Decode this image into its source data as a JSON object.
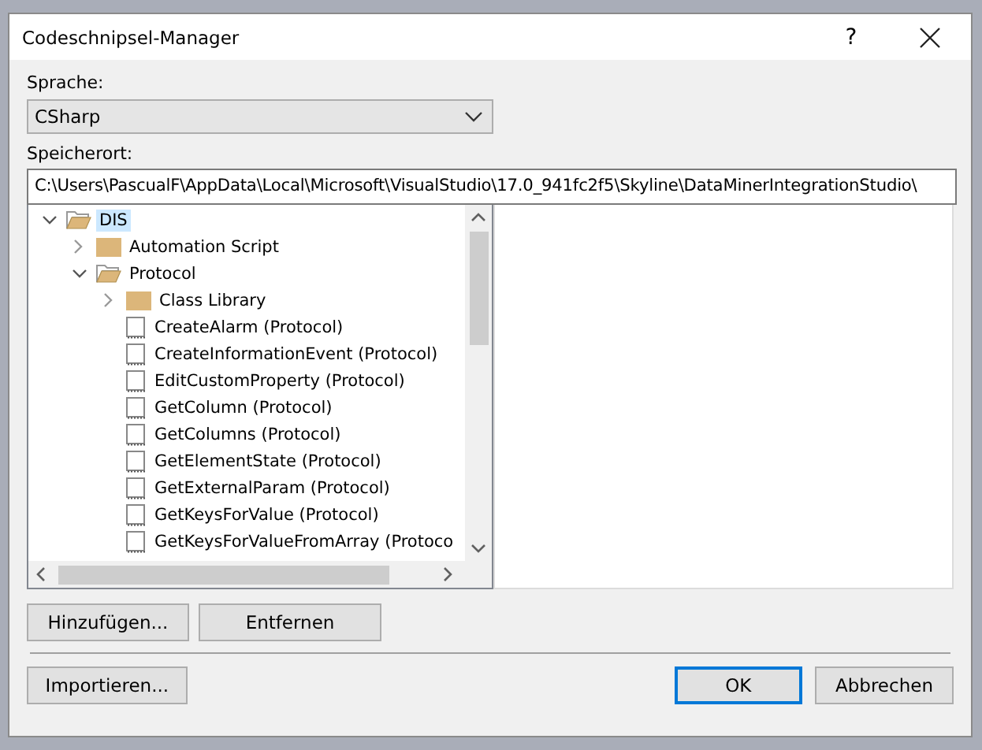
{
  "dialog": {
    "title": "Codeschnipsel-Manager",
    "help": "?"
  },
  "language": {
    "label": "Sprache:",
    "value": "CSharp"
  },
  "location": {
    "label": "Speicherort:",
    "value": "C:\\Users\\PascualF\\AppData\\Local\\Microsoft\\VisualStudio\\17.0_941fc2f5\\Skyline\\DataMinerIntegrationStudio\\"
  },
  "tree": [
    {
      "kind": "folder",
      "label": "DIS",
      "expanded": true,
      "selected": true,
      "children": [
        {
          "kind": "folder",
          "label": "Automation Script",
          "expanded": false,
          "selected": false
        },
        {
          "kind": "folder",
          "label": "Protocol",
          "expanded": true,
          "selected": false,
          "children": [
            {
              "kind": "folder",
              "label": "Class Library",
              "expanded": false,
              "selected": false
            },
            {
              "kind": "snippet",
              "label": "CreateAlarm (Protocol)",
              "selected": false
            },
            {
              "kind": "snippet",
              "label": "CreateInformationEvent (Protocol)",
              "selected": false
            },
            {
              "kind": "snippet",
              "label": "EditCustomProperty (Protocol)",
              "selected": false
            },
            {
              "kind": "snippet",
              "label": "GetColumn (Protocol)",
              "selected": false
            },
            {
              "kind": "snippet",
              "label": "GetColumns (Protocol)",
              "selected": false
            },
            {
              "kind": "snippet",
              "label": "GetElementState (Protocol)",
              "selected": false
            },
            {
              "kind": "snippet",
              "label": "GetExternalParam (Protocol)",
              "selected": false
            },
            {
              "kind": "snippet",
              "label": "GetKeysForValue (Protocol)",
              "selected": false
            },
            {
              "kind": "snippet",
              "label": "GetKeysForValueFromArray (Protoco",
              "selected": false
            }
          ]
        }
      ]
    }
  ],
  "tree_buttons": [
    {
      "label": "Hinzufügen...",
      "default": false
    },
    {
      "label": "Entfernen",
      "default": false
    }
  ],
  "footer_buttons": [
    {
      "label": "Importieren...",
      "default": false
    },
    {
      "label": "OK",
      "default": true
    },
    {
      "label": "Abbrechen",
      "default": false
    }
  ]
}
